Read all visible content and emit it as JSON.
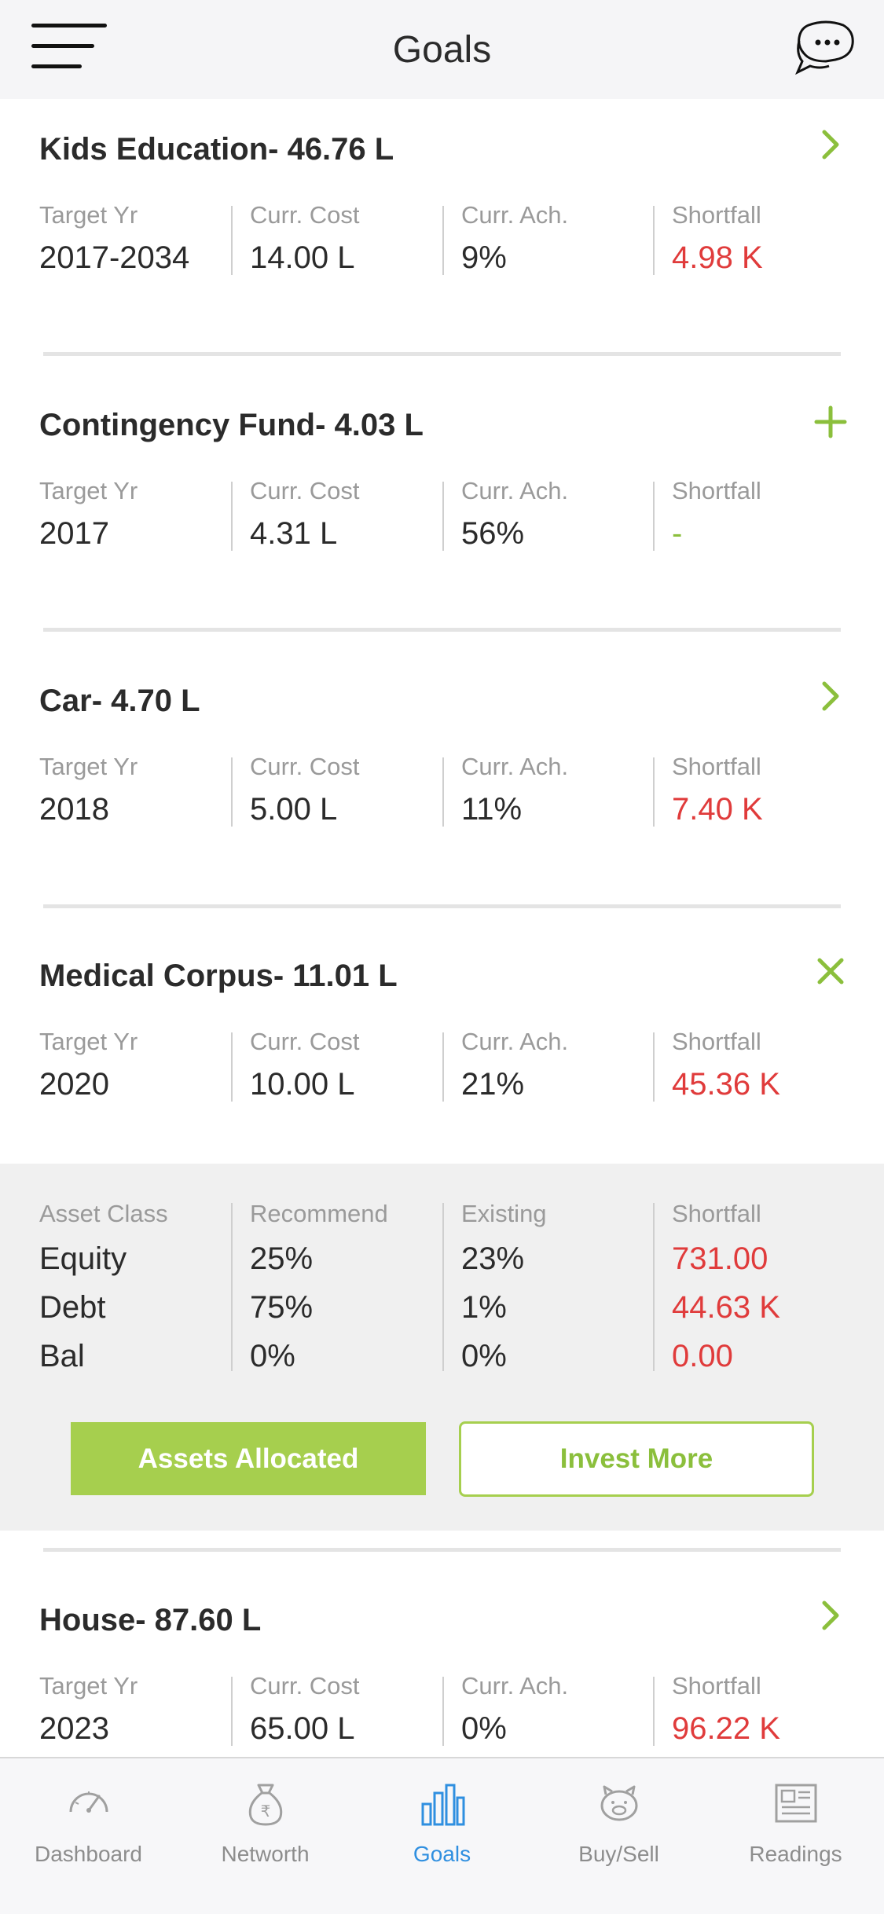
{
  "header": {
    "title": "Goals"
  },
  "colors": {
    "accent_green": "#a6cf4e",
    "shortfall_red": "#e03b3b",
    "active_tab_blue": "#2f8fe0"
  },
  "goals": [
    {
      "title": "Kids Education- 46.76 L",
      "action_icon": "chevron-right-icon",
      "stats": [
        {
          "label": "Target Yr",
          "value": "2017-2034"
        },
        {
          "label": "Curr. Cost",
          "value": "14.00 L"
        },
        {
          "label": "Curr. Ach.",
          "value": "9%"
        },
        {
          "label": "Shortfall",
          "value": "4.98 K"
        }
      ]
    },
    {
      "title": "Contingency Fund- 4.03 L",
      "action_icon": "plus-icon",
      "stats": [
        {
          "label": "Target Yr",
          "value": "2017"
        },
        {
          "label": "Curr. Cost",
          "value": "4.31 L"
        },
        {
          "label": "Curr. Ach.",
          "value": "56%"
        },
        {
          "label": "Shortfall",
          "value": "-"
        }
      ]
    },
    {
      "title": "Car- 4.70 L",
      "action_icon": "chevron-right-icon",
      "stats": [
        {
          "label": "Target Yr",
          "value": "2018"
        },
        {
          "label": "Curr. Cost",
          "value": "5.00 L"
        },
        {
          "label": "Curr. Ach.",
          "value": "11%"
        },
        {
          "label": "Shortfall",
          "value": "7.40 K"
        }
      ]
    },
    {
      "title": "Medical Corpus- 11.01 L",
      "action_icon": "close-icon",
      "stats": [
        {
          "label": "Target Yr",
          "value": "2020"
        },
        {
          "label": "Curr. Cost",
          "value": "10.00 L"
        },
        {
          "label": "Curr. Ach.",
          "value": "21%"
        },
        {
          "label": "Shortfall",
          "value": "45.36 K"
        }
      ],
      "allocation": {
        "headers": [
          "Asset Class",
          "Recommend",
          "Existing",
          "Shortfall"
        ],
        "rows": [
          [
            "Equity",
            "25%",
            "23%",
            "731.00"
          ],
          [
            "Debt",
            "75%",
            "1%",
            "44.63 K"
          ],
          [
            "Bal",
            "0%",
            "0%",
            "0.00"
          ]
        ],
        "assets_allocated_label": "Assets Allocated",
        "invest_more_label": "Invest More"
      }
    },
    {
      "title": "House- 87.60 L",
      "action_icon": "chevron-right-icon",
      "stats": [
        {
          "label": "Target Yr",
          "value": "2023"
        },
        {
          "label": "Curr. Cost",
          "value": "65.00 L"
        },
        {
          "label": "Curr. Ach.",
          "value": "0%"
        },
        {
          "label": "Shortfall",
          "value": "96.22 K"
        }
      ]
    }
  ],
  "tabs": [
    {
      "label": "Dashboard",
      "icon": "speedometer-icon",
      "active": false
    },
    {
      "label": "Networth",
      "icon": "money-bag-icon",
      "active": false
    },
    {
      "label": "Goals",
      "icon": "bar-chart-icon",
      "active": true
    },
    {
      "label": "Buy/Sell",
      "icon": "piggy-bank-icon",
      "active": false
    },
    {
      "label": "Readings",
      "icon": "newspaper-icon",
      "active": false
    }
  ]
}
